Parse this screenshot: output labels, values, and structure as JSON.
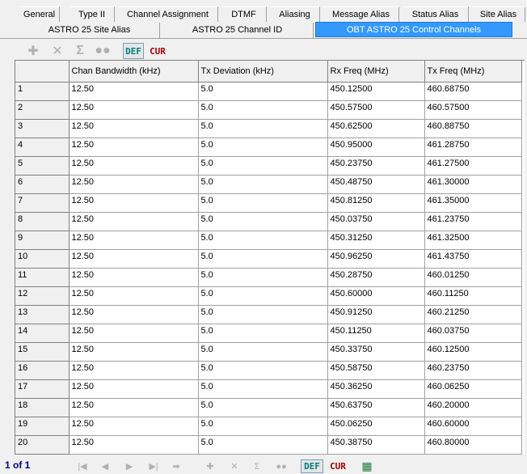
{
  "tabs_row1": [
    "General",
    "Type II",
    "Channel Assignment",
    "DTMF",
    "Aliasing",
    "Message Alias",
    "Status Alias",
    "Site Alias"
  ],
  "tabs_row2": [
    "ASTRO 25 Site Alias",
    "ASTRO 25 Channel ID",
    "OBT ASTRO 25 Control Channels"
  ],
  "active_tab": "OBT ASTRO 25 Control Channels",
  "toolbar": {
    "def_label": "DEF",
    "cur_label": "CUR"
  },
  "columns": [
    "Chan Bandwidth (kHz)",
    "Tx Deviation (kHz)",
    "Rx Freq (MHz)",
    "Tx Freq (MHz)"
  ],
  "rows": [
    {
      "n": "1",
      "bw": "12.50",
      "dev": "5.0",
      "rx": "450.12500",
      "tx": "460.68750"
    },
    {
      "n": "2",
      "bw": "12.50",
      "dev": "5.0",
      "rx": "450.57500",
      "tx": "460.57500"
    },
    {
      "n": "3",
      "bw": "12.50",
      "dev": "5.0",
      "rx": "450.62500",
      "tx": "460.88750"
    },
    {
      "n": "4",
      "bw": "12.50",
      "dev": "5.0",
      "rx": "450.95000",
      "tx": "461.28750"
    },
    {
      "n": "5",
      "bw": "12.50",
      "dev": "5.0",
      "rx": "450.23750",
      "tx": "461.27500"
    },
    {
      "n": "6",
      "bw": "12.50",
      "dev": "5.0",
      "rx": "450.48750",
      "tx": "461.30000"
    },
    {
      "n": "7",
      "bw": "12.50",
      "dev": "5.0",
      "rx": "450.81250",
      "tx": "461.35000"
    },
    {
      "n": "8",
      "bw": "12.50",
      "dev": "5.0",
      "rx": "450.03750",
      "tx": "461.23750"
    },
    {
      "n": "9",
      "bw": "12.50",
      "dev": "5.0",
      "rx": "450.31250",
      "tx": "461.32500"
    },
    {
      "n": "10",
      "bw": "12.50",
      "dev": "5.0",
      "rx": "450.96250",
      "tx": "461.43750"
    },
    {
      "n": "11",
      "bw": "12.50",
      "dev": "5.0",
      "rx": "450.28750",
      "tx": "460.01250"
    },
    {
      "n": "12",
      "bw": "12.50",
      "dev": "5.0",
      "rx": "450.60000",
      "tx": "460.11250"
    },
    {
      "n": "13",
      "bw": "12.50",
      "dev": "5.0",
      "rx": "450.91250",
      "tx": "460.21250"
    },
    {
      "n": "14",
      "bw": "12.50",
      "dev": "5.0",
      "rx": "450.11250",
      "tx": "460.03750"
    },
    {
      "n": "15",
      "bw": "12.50",
      "dev": "5.0",
      "rx": "450.33750",
      "tx": "460.12500"
    },
    {
      "n": "16",
      "bw": "12.50",
      "dev": "5.0",
      "rx": "450.58750",
      "tx": "460.23750"
    },
    {
      "n": "17",
      "bw": "12.50",
      "dev": "5.0",
      "rx": "450.36250",
      "tx": "460.06250"
    },
    {
      "n": "18",
      "bw": "12.50",
      "dev": "5.0",
      "rx": "450.63750",
      "tx": "460.20000"
    },
    {
      "n": "19",
      "bw": "12.50",
      "dev": "5.0",
      "rx": "450.06250",
      "tx": "460.60000"
    },
    {
      "n": "20",
      "bw": "12.50",
      "dev": "5.0",
      "rx": "450.38750",
      "tx": "460.80000"
    }
  ],
  "pager": "1 of 1",
  "bottom_toolbar": {
    "def_label": "DEF",
    "cur_label": "CUR"
  },
  "icons": [
    "add-row-icon",
    "delete-row-icon",
    "sum-icon",
    "link-icon",
    "first-icon",
    "prev-icon",
    "next-icon",
    "last-icon",
    "goto-icon",
    "grid-icon"
  ]
}
